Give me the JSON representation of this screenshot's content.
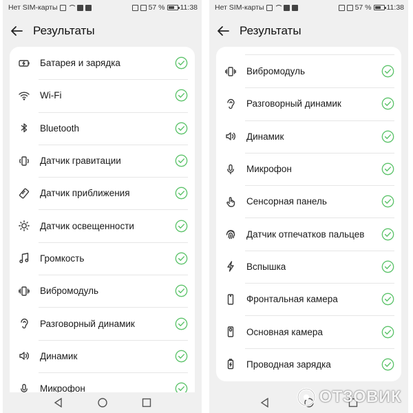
{
  "status_bar": {
    "carrier": "Нет SIM-карты",
    "battery_percent": "57 %",
    "time": "11:38"
  },
  "header": {
    "title": "Результаты"
  },
  "left_list": [
    {
      "label": "Батарея и зарядка",
      "icon": "battery-icon"
    },
    {
      "label": "Wi-Fi",
      "icon": "wifi-icon"
    },
    {
      "label": "Bluetooth",
      "icon": "bluetooth-icon"
    },
    {
      "label": "Датчик гравитации",
      "icon": "gravity-sensor-icon"
    },
    {
      "label": "Датчик приближения",
      "icon": "proximity-sensor-icon"
    },
    {
      "label": "Датчик освещенности",
      "icon": "brightness-icon"
    },
    {
      "label": "Громкость",
      "icon": "music-note-icon"
    },
    {
      "label": "Вибромодуль",
      "icon": "vibration-icon"
    },
    {
      "label": "Разговорный динамик",
      "icon": "ear-icon"
    },
    {
      "label": "Динамик",
      "icon": "speaker-icon"
    },
    {
      "label": "Микрофон",
      "icon": "microphone-icon"
    }
  ],
  "right_list": [
    {
      "label": "Вибромодуль",
      "icon": "vibration-icon"
    },
    {
      "label": "Разговорный динамик",
      "icon": "ear-icon"
    },
    {
      "label": "Динамик",
      "icon": "speaker-icon"
    },
    {
      "label": "Микрофон",
      "icon": "microphone-icon"
    },
    {
      "label": "Сенсорная панель",
      "icon": "touch-icon"
    },
    {
      "label": "Датчик отпечатков пальцев",
      "icon": "fingerprint-icon"
    },
    {
      "label": "Вспышка",
      "icon": "flash-icon"
    },
    {
      "label": "Фронтальная камера",
      "icon": "front-camera-icon"
    },
    {
      "label": "Основная камера",
      "icon": "main-camera-icon"
    },
    {
      "label": "Проводная зарядка",
      "icon": "wired-charging-icon"
    }
  ],
  "status_icon": "check-circle-icon",
  "colors": {
    "check": "#5cc36a",
    "background": "#f0f0f0",
    "card": "#ffffff"
  },
  "watermark": {
    "text": "ОТЗОВИК"
  }
}
